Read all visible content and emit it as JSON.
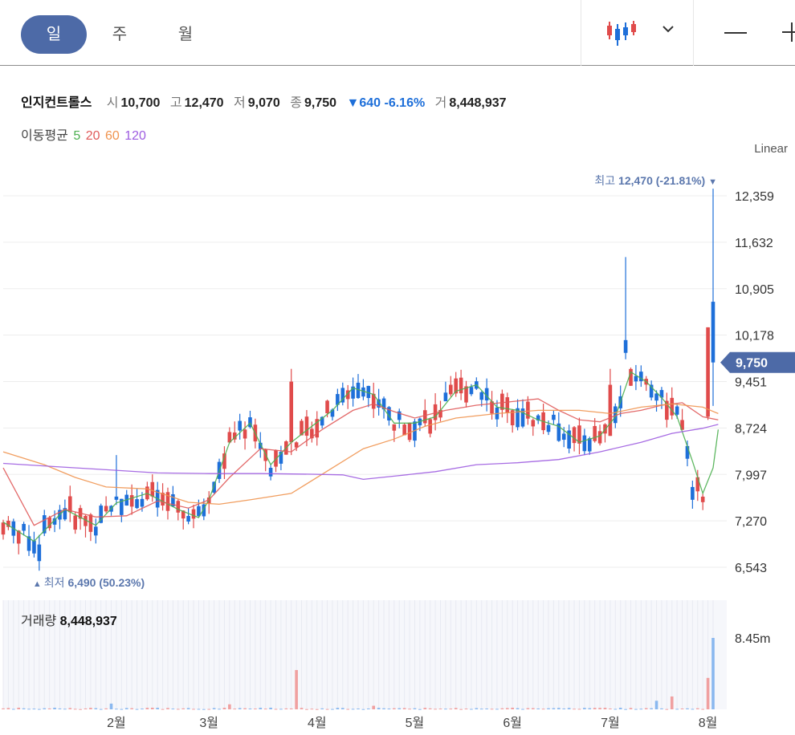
{
  "toolbar": {
    "tabs": [
      {
        "label": "일",
        "active": true
      },
      {
        "label": "주",
        "active": false
      },
      {
        "label": "월",
        "active": false
      }
    ],
    "chart_type_icon": "candlestick-icon",
    "dropdown_icon": "chevron-down-icon",
    "tools": [
      "minus-icon",
      "plus-icon"
    ]
  },
  "stock": {
    "name": "인지컨트롤스",
    "open_label": "시",
    "open": "10,700",
    "high_label": "고",
    "high": "12,470",
    "low_label": "저",
    "low": "9,070",
    "close_label": "종",
    "close": "9,750",
    "change_arrow": "▼",
    "change": "640",
    "change_pct": "-6.16%",
    "volume_label": "거",
    "volume": "8,448,937"
  },
  "moving_average": {
    "label": "이동평균",
    "periods": [
      {
        "label": "5",
        "color": "#4caf50"
      },
      {
        "label": "20",
        "color": "#e05a5a"
      },
      {
        "label": "60",
        "color": "#f0944f"
      },
      {
        "label": "120",
        "color": "#9d5ce0"
      }
    ]
  },
  "scale_mode": "Linear",
  "annotations": {
    "high_label": "최고",
    "high_value": "12,470 (-21.81%)",
    "high_arrow": "▼",
    "low_label": "최저",
    "low_value": "6,490 (50.23%)",
    "low_arrow": "▲",
    "current_price": "9,750"
  },
  "volume_panel": {
    "label": "거래량",
    "value": "8,448,937",
    "axis_label": "8.45m"
  },
  "colors": {
    "up": "#e04b4b",
    "down": "#1e6fd9",
    "accent": "#4d6aa7",
    "grid": "#ececec"
  },
  "chart_data": {
    "type": "candlestick",
    "title": "",
    "y_ticks": [
      "12,359",
      "11,632",
      "10,905",
      "10,178",
      "9,451",
      "8,724",
      "7,997",
      "7,270",
      "6,543"
    ],
    "ylim": [
      6543,
      12359
    ],
    "x_ticks": [
      "2월",
      "3월",
      "4월",
      "5월",
      "6월",
      "7월",
      "8월"
    ],
    "x_tick_bars": [
      22,
      40,
      61,
      80,
      99,
      118,
      137
    ],
    "total_bars": 139,
    "ma_lines": [
      {
        "name": "5",
        "color": "#4caf50",
        "points": [
          [
            0,
            7250
          ],
          [
            6,
            6950
          ],
          [
            12,
            7450
          ],
          [
            18,
            7200
          ],
          [
            22,
            7550
          ],
          [
            28,
            7700
          ],
          [
            34,
            7450
          ],
          [
            38,
            7320
          ],
          [
            40,
            7600
          ],
          [
            44,
            8500
          ],
          [
            48,
            8800
          ],
          [
            52,
            8150
          ],
          [
            56,
            8500
          ],
          [
            60,
            8750
          ],
          [
            64,
            9000
          ],
          [
            68,
            9350
          ],
          [
            72,
            9250
          ],
          [
            76,
            8800
          ],
          [
            80,
            8800
          ],
          [
            84,
            8900
          ],
          [
            88,
            9300
          ],
          [
            92,
            9400
          ],
          [
            96,
            9050
          ],
          [
            100,
            9000
          ],
          [
            104,
            8850
          ],
          [
            108,
            8750
          ],
          [
            112,
            8500
          ],
          [
            116,
            8600
          ],
          [
            119,
            8900
          ],
          [
            122,
            9600
          ],
          [
            125,
            9450
          ],
          [
            128,
            9200
          ],
          [
            131,
            8900
          ],
          [
            134,
            8200
          ],
          [
            136,
            7700
          ],
          [
            138,
            8100
          ],
          [
            139,
            8700
          ]
        ]
      },
      {
        "name": "20",
        "color": "#e05a5a",
        "points": [
          [
            0,
            8100
          ],
          [
            6,
            7200
          ],
          [
            12,
            7450
          ],
          [
            18,
            7330
          ],
          [
            24,
            7350
          ],
          [
            30,
            7580
          ],
          [
            36,
            7470
          ],
          [
            40,
            7600
          ],
          [
            44,
            7950
          ],
          [
            50,
            8400
          ],
          [
            56,
            8350
          ],
          [
            62,
            8700
          ],
          [
            68,
            9000
          ],
          [
            72,
            9100
          ],
          [
            76,
            8980
          ],
          [
            80,
            8880
          ],
          [
            86,
            9000
          ],
          [
            92,
            9080
          ],
          [
            98,
            9130
          ],
          [
            104,
            9180
          ],
          [
            108,
            9000
          ],
          [
            112,
            8850
          ],
          [
            116,
            8820
          ],
          [
            120,
            8950
          ],
          [
            124,
            9000
          ],
          [
            128,
            9080
          ],
          [
            132,
            9120
          ],
          [
            136,
            8900
          ],
          [
            139,
            8850
          ]
        ]
      },
      {
        "name": "60",
        "color": "#f0944f",
        "points": [
          [
            0,
            8350
          ],
          [
            8,
            8150
          ],
          [
            14,
            7950
          ],
          [
            20,
            7800
          ],
          [
            28,
            7770
          ],
          [
            36,
            7560
          ],
          [
            42,
            7530
          ],
          [
            48,
            7600
          ],
          [
            56,
            7700
          ],
          [
            64,
            8100
          ],
          [
            70,
            8400
          ],
          [
            76,
            8550
          ],
          [
            82,
            8750
          ],
          [
            88,
            8880
          ],
          [
            96,
            8950
          ],
          [
            104,
            9000
          ],
          [
            112,
            9000
          ],
          [
            118,
            8950
          ],
          [
            124,
            9050
          ],
          [
            130,
            9100
          ],
          [
            136,
            9050
          ],
          [
            139,
            8950
          ]
        ]
      },
      {
        "name": "120",
        "color": "#9d5ce0",
        "points": [
          [
            0,
            8170
          ],
          [
            10,
            8120
          ],
          [
            20,
            8070
          ],
          [
            30,
            8020
          ],
          [
            40,
            8010
          ],
          [
            50,
            8010
          ],
          [
            60,
            8000
          ],
          [
            66,
            7990
          ],
          [
            70,
            7920
          ],
          [
            76,
            7970
          ],
          [
            84,
            8040
          ],
          [
            92,
            8150
          ],
          [
            100,
            8180
          ],
          [
            108,
            8230
          ],
          [
            116,
            8350
          ],
          [
            124,
            8500
          ],
          [
            130,
            8640
          ],
          [
            136,
            8720
          ],
          [
            139,
            8780
          ]
        ]
      }
    ],
    "volume_max": 8448937
  }
}
